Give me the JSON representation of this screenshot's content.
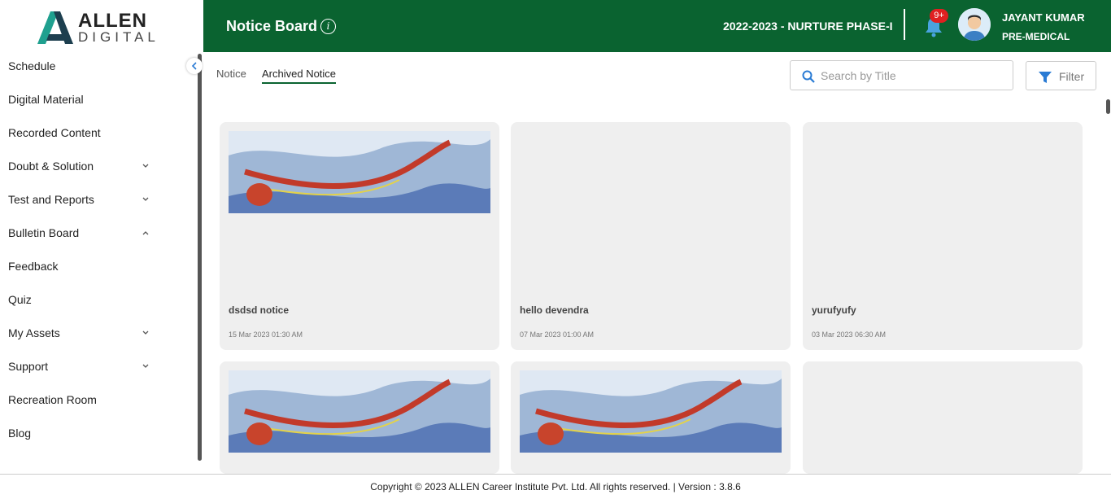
{
  "brand": {
    "name": "ALLEN",
    "sub": "DIGITAL",
    "colors": {
      "primary": "#0a6330",
      "logo_teal": "#1fa08f",
      "logo_dark": "#1d3f4f"
    }
  },
  "header": {
    "title": "Notice Board",
    "info_icon": "info-icon",
    "session": "2022-2023 - NURTURE PHASE-I",
    "notification_badge": "9+",
    "user": {
      "name": "JAYANT KUMAR",
      "role": "PRE-MEDICAL"
    }
  },
  "sidebar": {
    "items": [
      {
        "label": "Schedule",
        "chevron": ""
      },
      {
        "label": "Digital Material",
        "chevron": ""
      },
      {
        "label": "Recorded Content",
        "chevron": ""
      },
      {
        "label": "Doubt & Solution",
        "chevron": "down"
      },
      {
        "label": "Test and Reports",
        "chevron": "down"
      },
      {
        "label": "Bulletin Board",
        "chevron": "up"
      },
      {
        "label": "Feedback",
        "chevron": ""
      },
      {
        "label": "Quiz",
        "chevron": ""
      },
      {
        "label": "My Assets",
        "chevron": "down"
      },
      {
        "label": "Support",
        "chevron": "down"
      },
      {
        "label": "Recreation Room",
        "chevron": ""
      },
      {
        "label": "Blog",
        "chevron": ""
      }
    ]
  },
  "tabs": [
    {
      "label": "Notice",
      "active": false
    },
    {
      "label": "Archived Notice",
      "active": true
    }
  ],
  "search": {
    "placeholder": "Search by Title",
    "value": ""
  },
  "filter": {
    "label": "Filter"
  },
  "notices": [
    {
      "title": "dsdsd notice",
      "date": "15 Mar 2023 01:30 AM",
      "has_image": true
    },
    {
      "title": "hello devendra",
      "date": "07 Mar 2023 01:00 AM",
      "has_image": false
    },
    {
      "title": "yurufyufy",
      "date": "03 Mar 2023 06:30 AM",
      "has_image": false
    },
    {
      "title": "",
      "date": "",
      "has_image": true
    },
    {
      "title": "",
      "date": "",
      "has_image": true
    },
    {
      "title": "",
      "date": "",
      "has_image": false
    }
  ],
  "footer": {
    "text": "Copyright © 2023 ALLEN Career Institute Pvt. Ltd. All rights reserved. | Version : 3.8.6"
  }
}
